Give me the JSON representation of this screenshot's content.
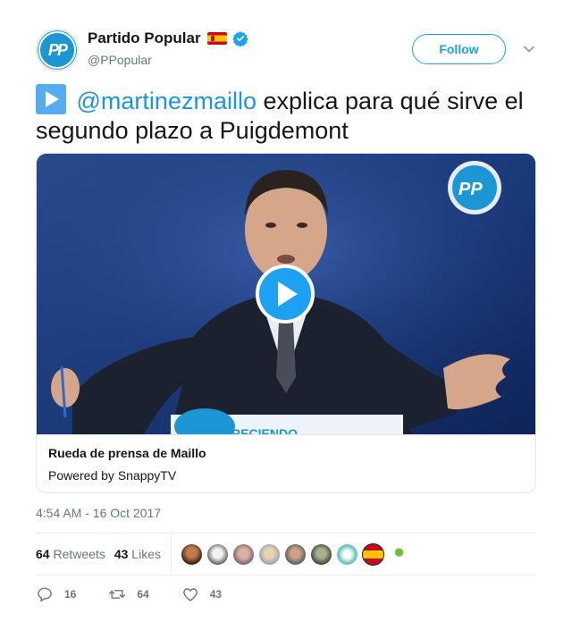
{
  "author": {
    "display_name": "Partido Popular",
    "handle": "@PPopular",
    "avatar_text": "PP",
    "flag_icon": "spain-flag-icon",
    "verified_icon": "verified-badge-icon",
    "verified_color": "#1da1f2"
  },
  "header": {
    "follow_label": "Follow",
    "caret_icon": "chevron-down-icon"
  },
  "tweet": {
    "emoji_icon": "play-button-emoji-icon",
    "mention": "@martinezmaillo",
    "text": " explica para qué sirve el segundo plazo a Puigdemont"
  },
  "card": {
    "media_logo": "PP",
    "podium_text": "CRECIENDO",
    "title": "Rueda de prensa de Maillo",
    "subtitle": "Powered by SnappyTV"
  },
  "timestamp": "4:54 AM - 16 Oct 2017",
  "stats": {
    "retweets_count": "64",
    "retweets_label": "Retweets",
    "likes_count": "43",
    "likes_label": "Likes"
  },
  "actions": {
    "reply_count": "16",
    "retweet_count": "64",
    "like_count": "43"
  },
  "colors": {
    "accent": "#1da1f2",
    "link": "#1b95e0",
    "muted": "#657786"
  }
}
